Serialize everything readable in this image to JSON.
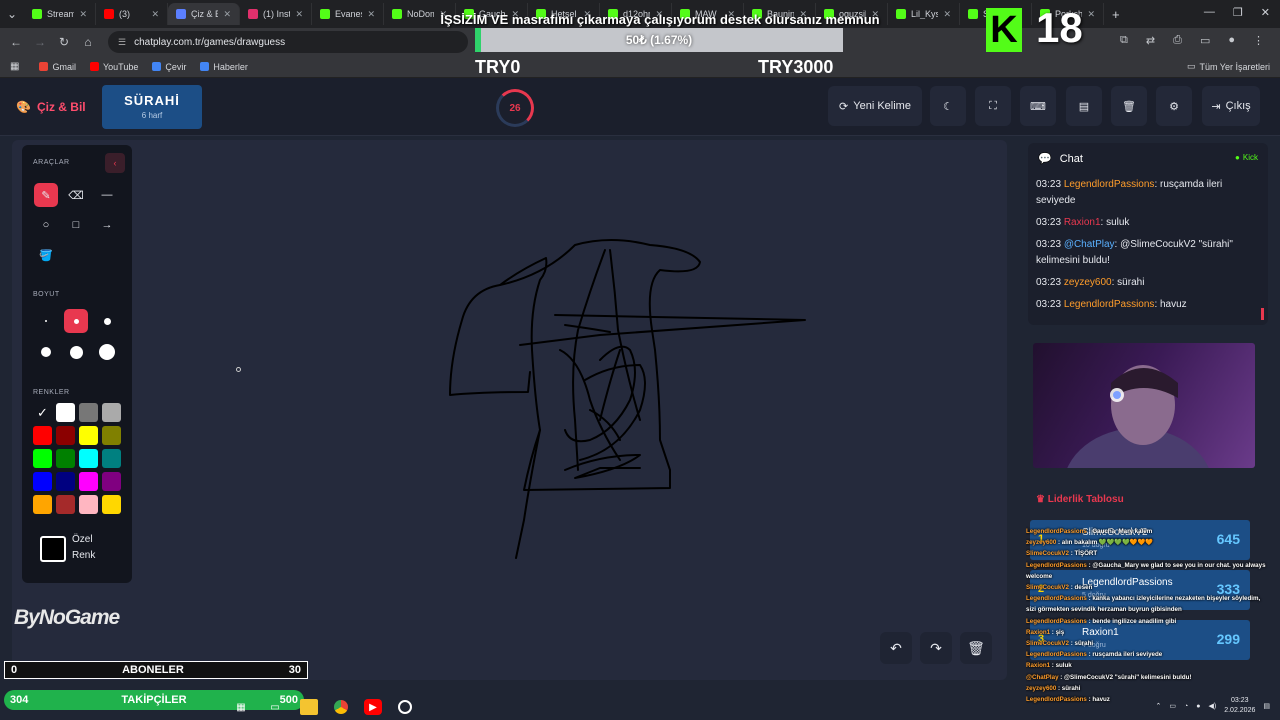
{
  "browser": {
    "tabs": [
      {
        "label": "Stream",
        "color": "#53fc18"
      },
      {
        "label": "(3)",
        "color": "#ff0000"
      },
      {
        "label": "Çiz & Bi",
        "color": "#5b7fff"
      },
      {
        "label": "(1) Insta",
        "color": "#e1306c"
      },
      {
        "label": "Evanes",
        "color": "#53fc18"
      },
      {
        "label": "NoDom",
        "color": "#53fc18"
      },
      {
        "label": "Gaucha",
        "color": "#53fc18"
      },
      {
        "label": "Hetsel",
        "color": "#53fc18"
      },
      {
        "label": "d12ohn",
        "color": "#53fc18"
      },
      {
        "label": "MAW",
        "color": "#53fc18"
      },
      {
        "label": "Baunin",
        "color": "#53fc18"
      },
      {
        "label": "oguzsik",
        "color": "#53fc18"
      },
      {
        "label": "Lil_Kysa",
        "color": "#53fc18"
      },
      {
        "label": "SkA",
        "color": "#53fc18"
      },
      {
        "label": "Porkch",
        "color": "#53fc18"
      }
    ],
    "url": "chatplay.com.tr/games/drawguess",
    "bookmarks": [
      {
        "label": "Gmail",
        "color": "#ea4335"
      },
      {
        "label": "YouTube",
        "color": "#ff0000"
      },
      {
        "label": "Çevir",
        "color": "#4285f4"
      },
      {
        "label": "Haberler",
        "color": "#4285f4"
      }
    ],
    "bookmarks_right": "Tüm Yer İşaretleri"
  },
  "overlay": {
    "donation_title": "İŞSİZİM VE masrafımı çıkarmaya çalışıyorum destek olursanız memnun olurum",
    "goal_text": "50₺ (1.67%)",
    "goal_percent": 1.67,
    "goal_min": "TRY0",
    "goal_max": "TRY3000",
    "age_badge": "K",
    "age_number": "18"
  },
  "game": {
    "logo": "Çiz & Bil",
    "word": "SÜRAHİ",
    "word_hint": "6 harf",
    "timer": "26",
    "buttons": {
      "new_word": "Yeni Kelime",
      "exit": "Çıkış"
    }
  },
  "tools": {
    "tools_title": "ARAÇLAR",
    "size_title": "BOYUT",
    "colors_title": "RENKLER",
    "custom_color_line1": "Özel",
    "custom_color_line2": "Renk",
    "colors": [
      "#ffffff",
      "#ffffff",
      "#777777",
      "#aaaaaa",
      "#ff0000",
      "#8b0000",
      "#ffff00",
      "#808000",
      "#00ff00",
      "#008000",
      "#00ffff",
      "#008080",
      "#0000ff",
      "#000080",
      "#ff00ff",
      "#800080",
      "#ffa500",
      "#a52a2a",
      "#ffb6c1",
      "#ffd700"
    ]
  },
  "chat": {
    "title": "Chat",
    "status": "Kick",
    "messages": [
      {
        "time": "03:23",
        "user": "LegendlordPassions",
        "color": "#ff9d2b",
        "text": ": rusçamda ileri seviyede"
      },
      {
        "time": "03:23",
        "user": "Raxion1",
        "color": "#e8384f",
        "text": ": suluk"
      },
      {
        "time": "03:23",
        "user": "@ChatPlay",
        "color": "#5ab0ff",
        "text": ": @SlimeCocukV2 \"sürahi\" kelimesini buldu!"
      },
      {
        "time": "03:23",
        "user": "zeyzey600",
        "color": "#ff9d2b",
        "text": ": sürahi"
      },
      {
        "time": "03:23",
        "user": "LegendlordPassions",
        "color": "#ff9d2b",
        "text": ": havuz"
      }
    ]
  },
  "leaderboard": {
    "title": "Liderlik Tablosu",
    "rows": [
      {
        "rank": "1",
        "name": "SlimeCocukV2",
        "sub": "10 doğru",
        "score": "645"
      },
      {
        "rank": "2",
        "name": "LegendlordPassions",
        "sub": "5 doğru",
        "score": "333"
      },
      {
        "rank": "3",
        "name": "Raxion1",
        "sub": "4 doğru",
        "score": "299"
      }
    ]
  },
  "overlay_chat": [
    {
      "user": "LegendlordPassions",
      "text": " : Gaucha_Mary kalem"
    },
    {
      "user": "zeyzey600",
      "text": " : alın bakalım 💚💚💚💚🧡🧡🧡"
    },
    {
      "user": "SlimeCocukV2",
      "text": " : TİŞÖRT"
    },
    {
      "user": "LegendlordPassions",
      "text": " : @Gaucha_Mary we glad to see you in our chat. you always"
    },
    {
      "user": "",
      "text": "welcome"
    },
    {
      "user": "SlimeCocukV2",
      "text": " : desen"
    },
    {
      "user": "LegendlordPassions",
      "text": " : kanka yabancı izleyicilerine nezaketen bişeyler söyledim,"
    },
    {
      "user": "",
      "text": "sizi görmekten sevindik herzaman buyrun gibisinden"
    },
    {
      "user": "LegendlordPassions",
      "text": " : bende ingilizce anadilim gibi"
    },
    {
      "user": "Raxion1",
      "text": " : şiş"
    },
    {
      "user": "SlimeCocukV2",
      "text": " : sürahi"
    },
    {
      "user": "LegendlordPassions",
      "text": " : rusçamda ileri seviyede"
    },
    {
      "user": "Raxion1",
      "text": " : suluk"
    },
    {
      "user": "@ChatPlay",
      "text": " : @SlimeCocukV2 \"sürahi\" kelimesini buldu!"
    },
    {
      "user": "zeyzey600",
      "text": " : sürahi"
    },
    {
      "user": "LegendlordPassions",
      "text": " : havuz"
    }
  ],
  "bars": {
    "abone_min": "0",
    "abone_label": "ABONELER",
    "abone_max": "30",
    "takip_min": "304",
    "takip_label": "TAKİPÇİLER",
    "takip_max": "500"
  },
  "stream_logo": "ByNoGame",
  "taskbar": {
    "time": "03:23",
    "date": "2.02.2026"
  }
}
